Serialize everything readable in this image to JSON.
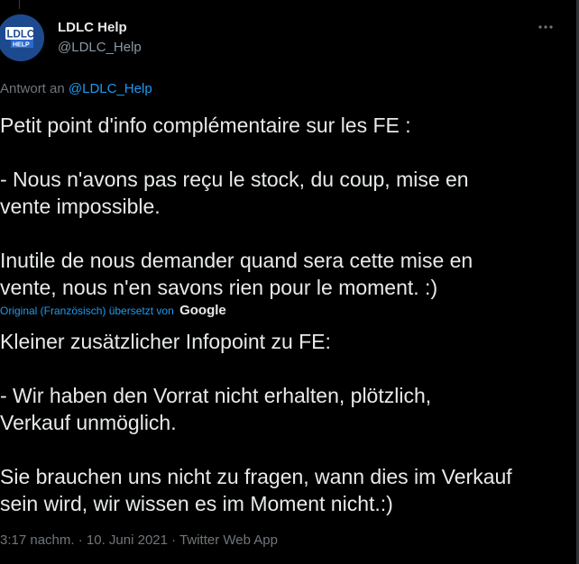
{
  "tweet": {
    "author": {
      "display_name": "LDLC Help",
      "handle": "@LDLC_Help",
      "avatar_logo_text": "LDLC",
      "avatar_sub_text": "HELP"
    },
    "more_menu_icon": "more-horizontal-icon",
    "reply_prefix": "Antwort an",
    "reply_to": "@LDLC_Help",
    "original_text": "Petit point d'info complémentaire sur les FE :\n\n- Nous n'avons pas reçu le stock, du coup, mise en\nvente impossible.\n\nInutile de nous demander quand sera cette mise en\nvente, nous n'en savons rien pour le moment. :)",
    "translation_credit": "Original (Französisch) übersetzt von",
    "translation_provider": "Google",
    "translated_text": "Kleiner zusätzlicher Infopoint zu FE:\n\n - Wir haben den Vorrat nicht erhalten, plötzlich,\nVerkauf unmöglich.\n\n Sie brauchen uns nicht zu fragen, wann dies im Verkauf\nsein wird, wir wissen es im Moment nicht.:)",
    "time": "3:17 nachm.",
    "date": "10. Juni 2021",
    "source": "Twitter Web App",
    "separator": " · "
  },
  "colors": {
    "background": "#000000",
    "text_primary": "#e7e9ea",
    "text_secondary": "#71767b",
    "link": "#1d9bf0",
    "avatar_bg": "#1d4a8f"
  }
}
